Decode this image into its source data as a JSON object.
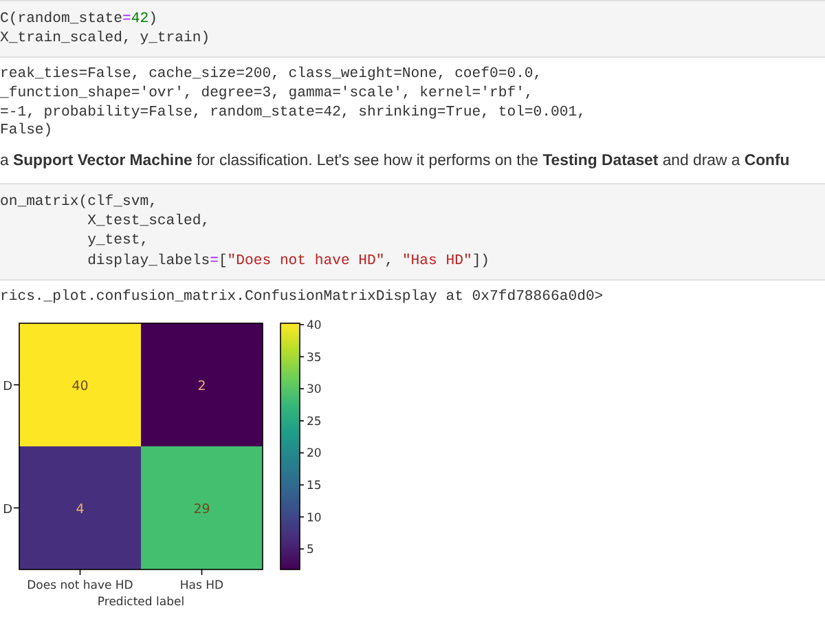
{
  "cells": [
    {
      "kind": "code",
      "lines": [
        [
          {
            "text": "C(random_state"
          },
          {
            "text": "=",
            "kind": "op"
          },
          {
            "text": "42",
            "kind": "num"
          },
          {
            "text": ")"
          }
        ],
        [
          {
            "text": "X_train_scaled, y_train)"
          }
        ]
      ]
    },
    {
      "kind": "output",
      "lines": [
        "reak_ties=False, cache_size=200, class_weight=None, coef0=0.0,",
        "_function_shape='ovr', degree=3, gamma='scale', kernel='rbf',",
        "=-1, probability=False, random_state=42, shrinking=True, tol=0.001,",
        "False)"
      ]
    },
    {
      "kind": "markdown",
      "text": "a **Support Vector Machine** for classification. Let's see how it performs on the **Testing Dataset** and draw a **Confu**"
    },
    {
      "kind": "code",
      "lines": [
        [
          {
            "text": "on_matrix(clf_svm,"
          }
        ],
        [
          {
            "text": "          X_test_scaled,"
          }
        ],
        [
          {
            "text": "          y_test,"
          }
        ],
        [
          {
            "text": "          display_labels"
          },
          {
            "text": "=",
            "kind": "op"
          },
          {
            "text": "["
          },
          {
            "text": "\"Does not have HD\"",
            "kind": "str"
          },
          {
            "text": ", "
          },
          {
            "text": "\"Has HD\"",
            "kind": "str"
          },
          {
            "text": "])"
          }
        ]
      ]
    },
    {
      "kind": "output",
      "lines": [
        "rics._plot.confusion_matrix.ConfusionMatrixDisplay at 0x7fd78866a0d0>"
      ]
    },
    {
      "kind": "plot",
      "confusion_matrix": {
        "y_labels": [
          "D",
          "D"
        ],
        "x_labels": [
          "Does not have HD",
          "Has HD"
        ],
        "xlabel": "Predicted label",
        "rows": [
          [
            {
              "value": "40",
              "color": "#fde725"
            },
            {
              "value": "2",
              "color": "#440154"
            }
          ],
          [
            {
              "value": "4",
              "color": "#46307e"
            },
            {
              "value": "29",
              "color": "#44bf70"
            }
          ]
        ],
        "colorbar_ticks": [
          "40",
          "35",
          "30",
          "25",
          "20",
          "15",
          "10",
          "5"
        ]
      }
    }
  ]
}
